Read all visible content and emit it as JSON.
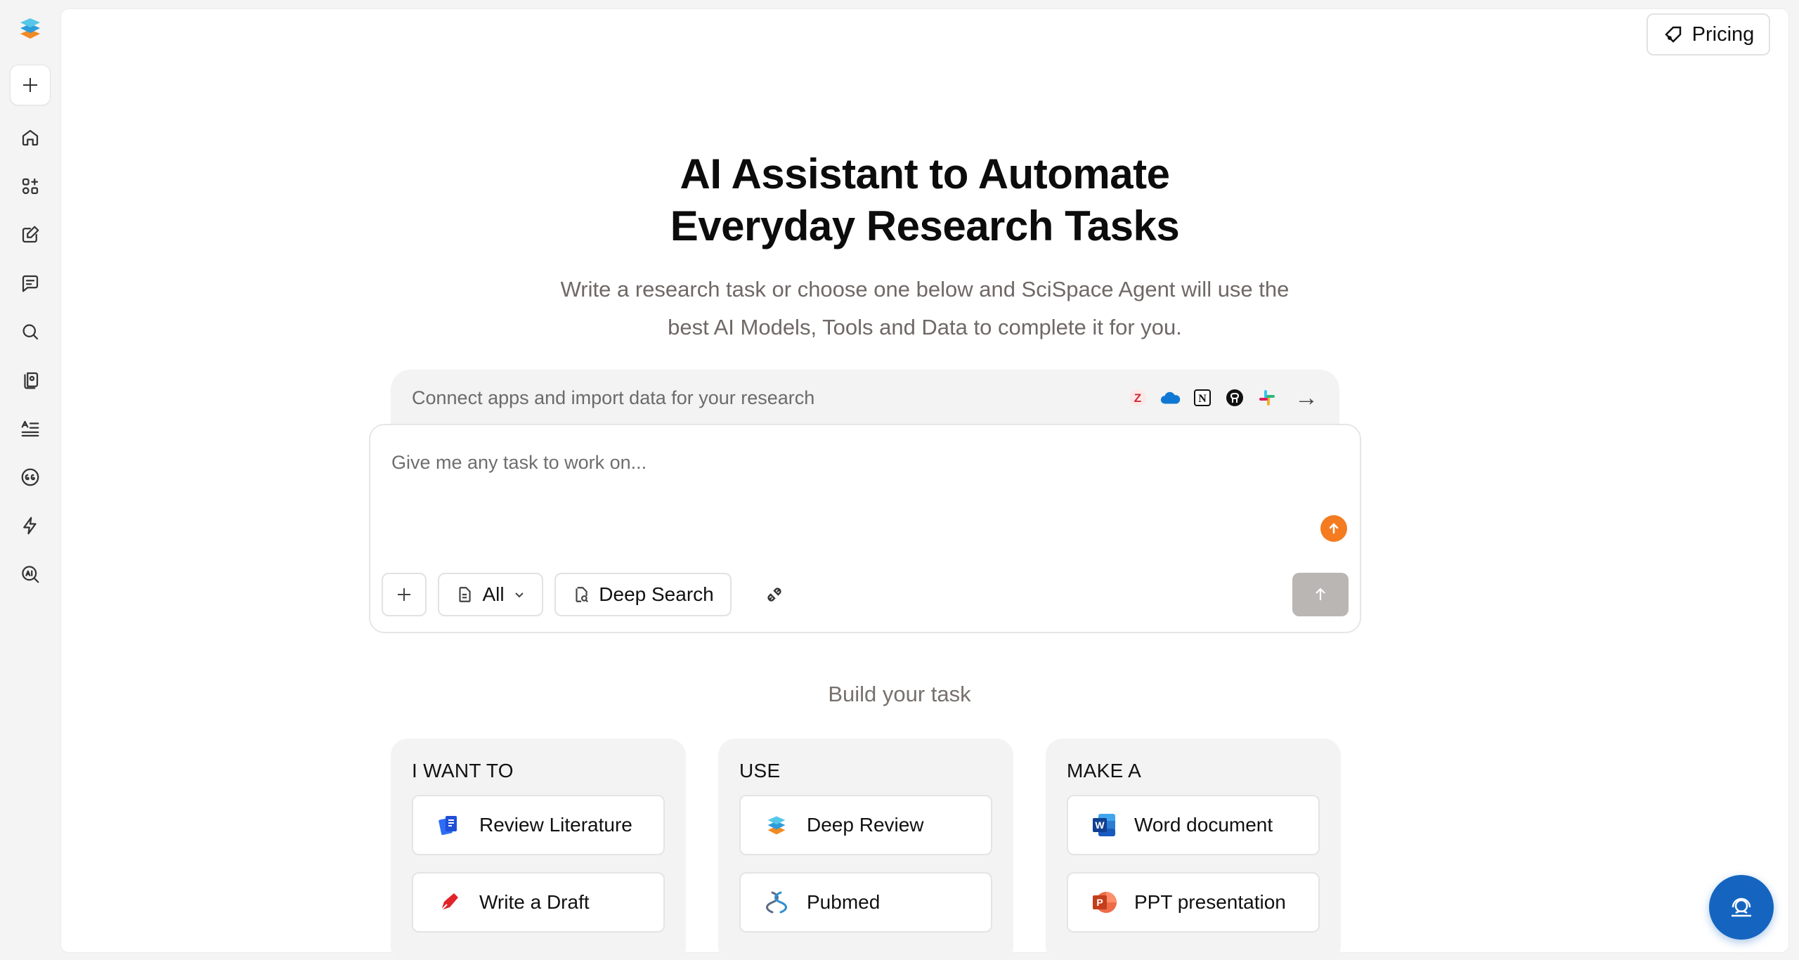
{
  "header": {
    "pricing_label": "Pricing"
  },
  "hero": {
    "title_line1": "AI Assistant to Automate",
    "title_line2": "Everyday Research Tasks",
    "subtitle_line1": "Write a research task or choose one below and SciSpace Agent will use the",
    "subtitle_line2": "best AI Models, Tools and Data to complete it for you."
  },
  "connect": {
    "text": "Connect apps and import data for your research",
    "apps": [
      "zotero-icon",
      "onedrive-icon",
      "notion-icon",
      "github-icon",
      "slack-icon"
    ]
  },
  "composer": {
    "placeholder": "Give me any task to work on...",
    "filter_label": "All",
    "mode_label": "Deep Search"
  },
  "build": {
    "label": "Build your task",
    "columns": [
      {
        "title": "I WANT TO",
        "items": [
          "Review Literature",
          "Write a Draft"
        ]
      },
      {
        "title": "USE",
        "items": [
          "Deep Review",
          "Pubmed"
        ]
      },
      {
        "title": "MAKE A",
        "items": [
          "Word document",
          "PPT presentation"
        ]
      }
    ]
  },
  "sidebar": {
    "items": [
      "home-icon",
      "apps-icon",
      "edit-icon",
      "chat-icon",
      "search-icon",
      "library-icon",
      "list-icon",
      "citation-icon",
      "bolt-icon",
      "ai-detector-icon"
    ]
  },
  "colors": {
    "accent_orange": "#f47b20",
    "fab_blue": "#1565c0",
    "send_disabled": "#b9b6b4"
  }
}
